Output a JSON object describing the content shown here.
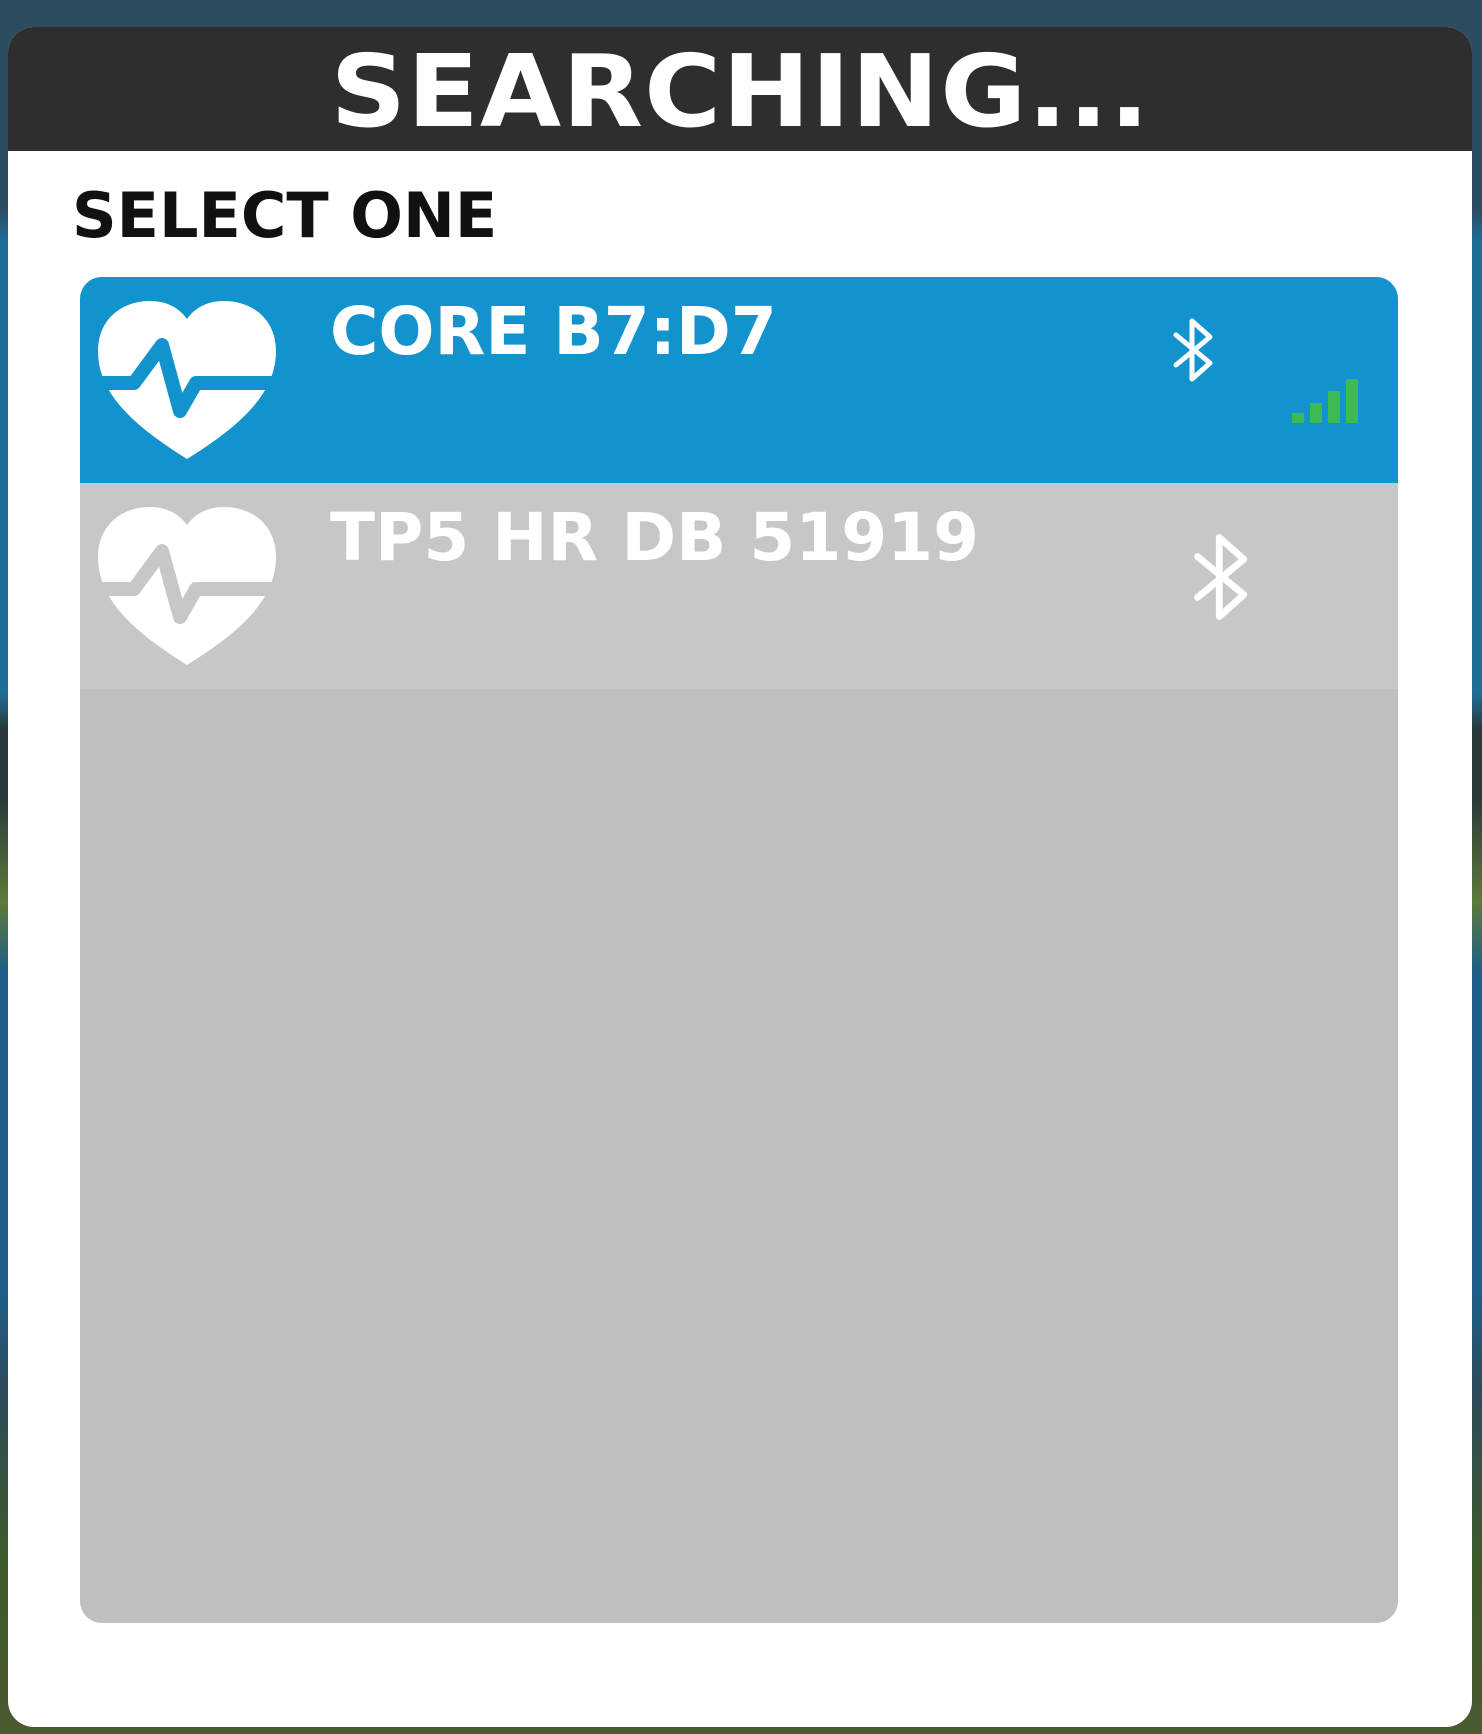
{
  "dialog": {
    "title": "SEARCHING...",
    "subtitle": "SELECT ONE"
  },
  "devices": [
    {
      "name": "CORE B7:D7",
      "icon": "heart-rate-icon",
      "connection_icon": "bluetooth-icon",
      "signal_icon": "signal-strength-icon",
      "signal_bars_lit": 4,
      "signal_bars_total": 4,
      "selected": true
    },
    {
      "name": "TP5 HR DB 51919",
      "icon": "heart-rate-icon",
      "connection_icon": "bluetooth-icon",
      "selected": false
    }
  ],
  "colors": {
    "titlebar": "#2e2e2e",
    "selected_row": "#1393cd",
    "unselected_row": "#c7c7c7",
    "list_background": "#bfbfbf",
    "signal": "#3dbb50"
  }
}
